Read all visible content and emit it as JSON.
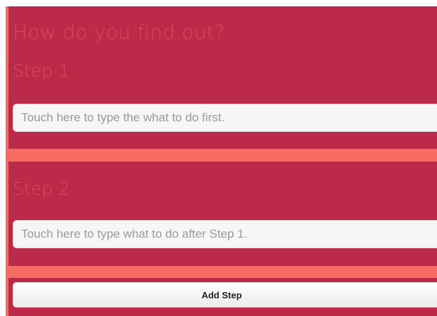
{
  "question": {
    "title": "How do you find out?"
  },
  "steps": [
    {
      "title": "Step 1",
      "placeholder": "Touch here to type the what to do first.",
      "value": ""
    },
    {
      "title": "Step 2",
      "placeholder": "Touch here to type what to do after Step 1.",
      "value": ""
    }
  ],
  "actions": {
    "add_step_label": "Add Step"
  },
  "colors": {
    "panel": "#bb2b49",
    "divider": "#f86b63",
    "heading": "#e0425f",
    "input_bg": "#f6f6f6"
  }
}
